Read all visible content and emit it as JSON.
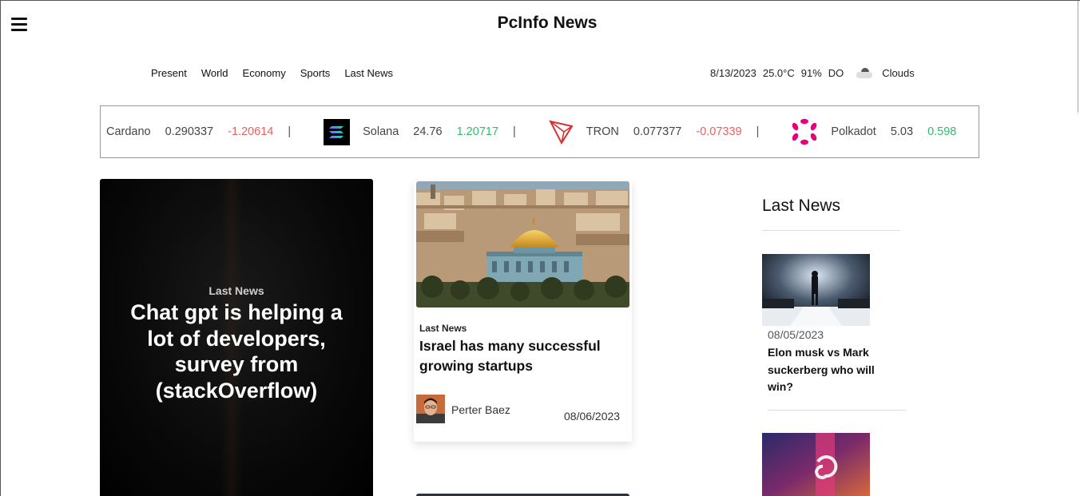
{
  "header": {
    "title": "PcInfo News",
    "menu_icon": "hamburger-menu-icon"
  },
  "nav": {
    "items": [
      "Present",
      "World",
      "Economy",
      "Sports",
      "Last News"
    ]
  },
  "weather": {
    "date": "8/13/2023",
    "temperature": "25.0°C",
    "humidity": "91%",
    "location": "DO",
    "condition": "Clouds",
    "icon": "cloud-icon"
  },
  "ticker": {
    "items": [
      {
        "name": "Cardano",
        "price": "0.290337",
        "change": "-1.20614",
        "icon": "cardano-icon"
      },
      {
        "name": "Solana",
        "price": "24.76",
        "change": "1.20717",
        "icon": "solana-icon"
      },
      {
        "name": "TRON",
        "price": "0.077377",
        "change": "-0.07339",
        "icon": "tron-icon"
      },
      {
        "name": "Polkadot",
        "price": "5.03",
        "change": "0.598",
        "icon": "polkadot-icon"
      }
    ],
    "separator": "|"
  },
  "hero": {
    "category": "Last News",
    "title": "Chat gpt is helping a lot of developers, survey from (stackOverflow)"
  },
  "card": {
    "category": "Last News",
    "title": "Israel has many successful growing startups",
    "author": "Perter Baez",
    "date": "08/06/2023"
  },
  "sidebar": {
    "title": "Last News",
    "items": [
      {
        "date": "08/05/2023",
        "title": "Elon musk vs Mark suckerberg who will win?"
      }
    ]
  },
  "colors": {
    "negative": "#e86060",
    "positive": "#2ebd6b",
    "polkadot": "#e6007a",
    "tron": "#d63031"
  }
}
